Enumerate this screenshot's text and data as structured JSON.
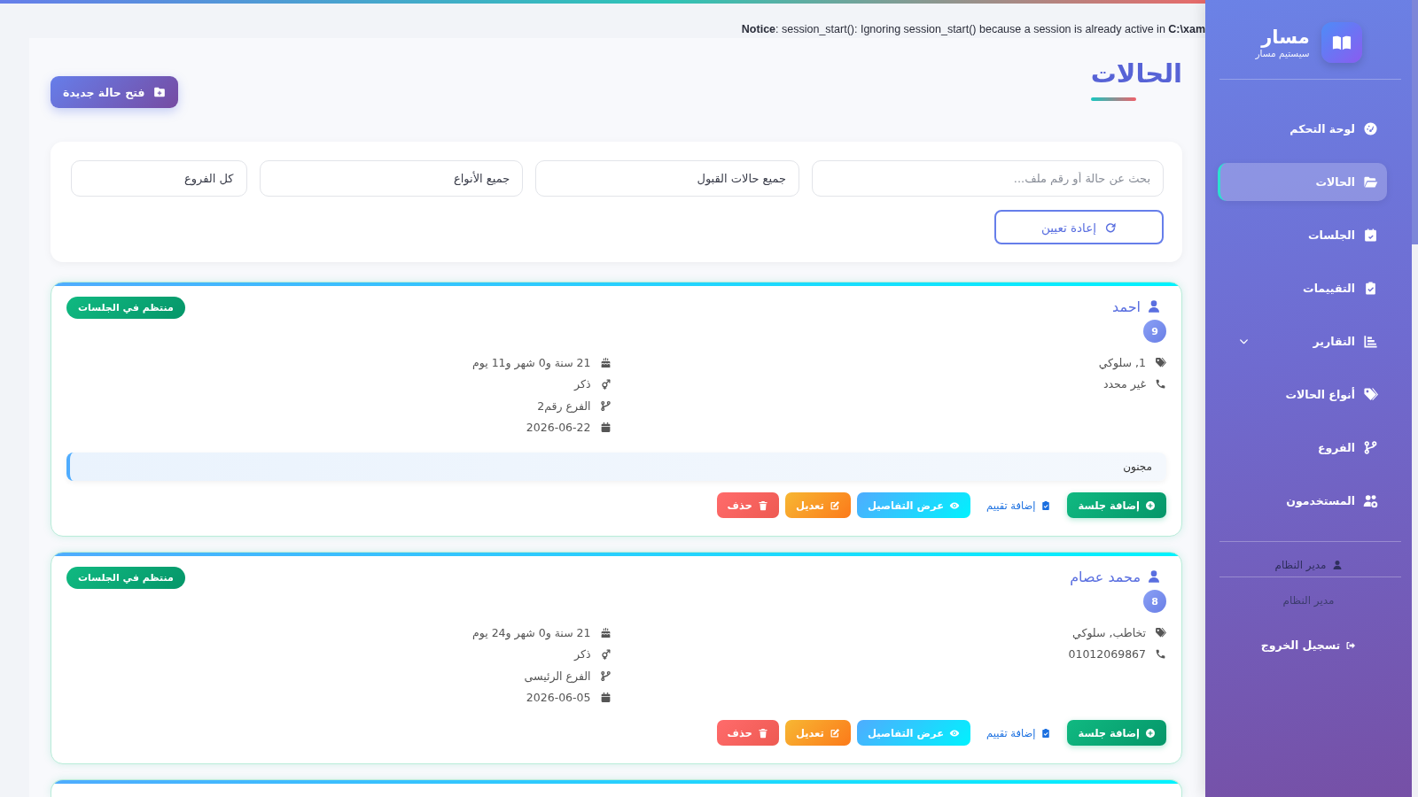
{
  "top_notice": {
    "text": "**Notice**: session_start(): Ignoring session_start() because a session is already active in **C:\\xam**"
  },
  "page": {
    "title": "الحالات",
    "new_button": "فتح حالة جديدة"
  },
  "filters": {
    "search": {
      "placeholder": "بحث عن حالة أو رقم ملف..."
    },
    "selects": [
      {
        "value": "جميع حالات القبول"
      },
      {
        "value": "جميع الأنواع"
      },
      {
        "value": "كل الفروع"
      }
    ],
    "reset_button": "إعادة تعيين"
  },
  "cases": [
    {
      "name": "احمد",
      "badge": "9",
      "status": "منتظم في الجلسات",
      "types": "1, سلوكي",
      "phone": "غير محدد",
      "age": "21 سنة و0 شهر و11 يوم",
      "gender": "ذكر",
      "branch": "الفرع رقم2",
      "date": "2026-06-22",
      "note": "مجنون",
      "actions": [
        {
          "label": "إضافة جلسة",
          "kind": "success"
        },
        {
          "label": "إضافة تقييم",
          "kind": "link"
        },
        {
          "label": "عرض التفاصيل",
          "kind": "info"
        },
        {
          "label": "تعديل",
          "kind": "warning"
        },
        {
          "label": "حذف",
          "kind": "danger"
        }
      ]
    },
    {
      "name": "محمد عصام",
      "badge": "8",
      "status": "منتظم في الجلسات",
      "types": "تخاطب, سلوكي",
      "phone": "01012069867",
      "age": "21 سنة و0 شهر و24 يوم",
      "gender": "ذكر",
      "branch": "الفرع الرئيسى",
      "date": "2026-06-05",
      "actions": [
        {
          "label": "إضافة جلسة",
          "kind": "success"
        },
        {
          "label": "إضافة تقييم",
          "kind": "link"
        },
        {
          "label": "عرض التفاصيل",
          "kind": "info"
        },
        {
          "label": "تعديل",
          "kind": "warning"
        },
        {
          "label": "حذف",
          "kind": "danger"
        }
      ]
    }
  ],
  "sidebar": {
    "brand": {
      "name": "مسار",
      "subtitle": "سيستيم مسار"
    },
    "menu": [
      {
        "label": "لوحة التحكم",
        "selected": false,
        "kind": "link"
      },
      {
        "label": "الحالات",
        "selected": true,
        "kind": "link"
      },
      {
        "label": "الجلسات",
        "selected": false,
        "kind": "link"
      },
      {
        "label": "التقييمات",
        "selected": false,
        "kind": "link"
      },
      {
        "label": "التقارير",
        "selected": false,
        "kind": "submenu"
      },
      {
        "label": "أنواع الحالات",
        "selected": false,
        "kind": "link"
      },
      {
        "label": "الفروع",
        "selected": false,
        "kind": "link"
      },
      {
        "label": "المستخدمون",
        "selected": false,
        "kind": "link"
      }
    ],
    "user": {
      "name": "مدير النظام",
      "role": "مدير النظام"
    },
    "logout": "تسجيل الخروج"
  }
}
